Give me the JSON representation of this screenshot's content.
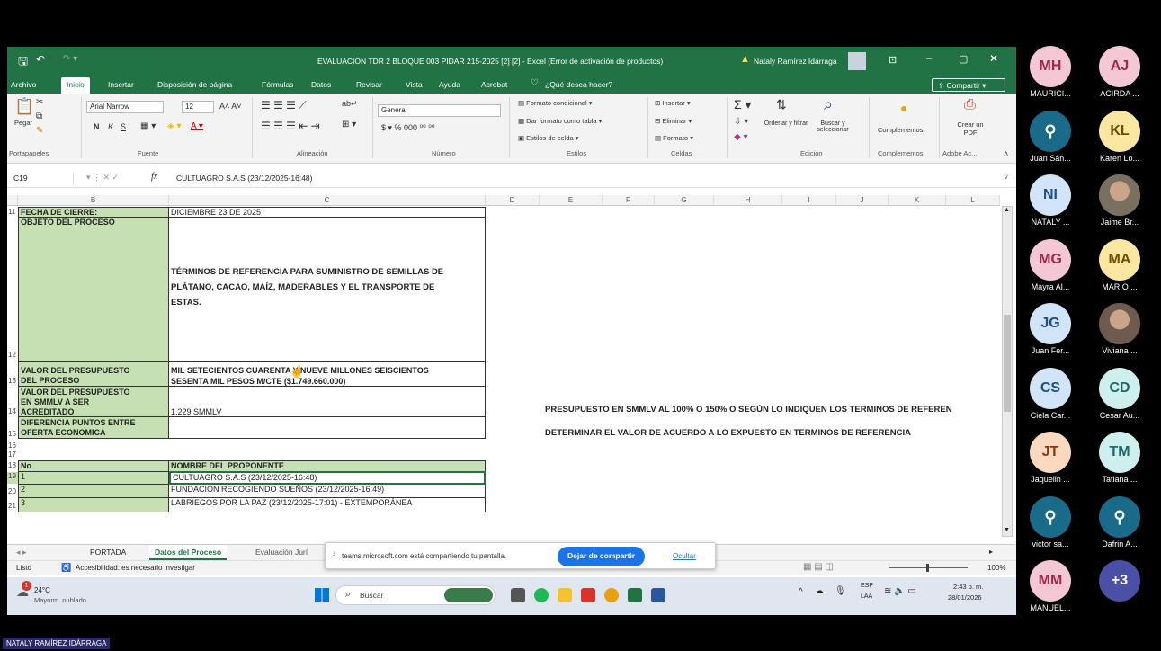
{
  "excel": {
    "doc_title": "EVALUACIÓN TDR 2 BLOQUE 003 PIDAR 215-2025 [2] [2] - Excel (Error de activación de productos)",
    "user_name": "Nataly Ramírez Idárraga",
    "tabs": [
      "Archivo",
      "Inicio",
      "Insertar",
      "Disposición de página",
      "Fórmulas",
      "Datos",
      "Revisar",
      "Vista",
      "Ayuda",
      "Acrobat"
    ],
    "search_placeholder": "¿Qué desea hacer?",
    "share_label": "Compartir",
    "ribbon": {
      "paste": "Pegar",
      "clipboard_group": "Portapapeles",
      "font_name": "Arial Narrow",
      "font_size": "12",
      "bold": "N",
      "italic": "K",
      "underline": "S",
      "font_group": "Fuente",
      "align_group": "Alineación",
      "number_format": "General",
      "number_group": "Número",
      "conditional": "Formato condicional",
      "as_table": "Dar formato como tabla",
      "cell_styles": "Estilos de celda",
      "styles_group": "Estilos",
      "insert": "Insertar",
      "delete": "Eliminar",
      "format": "Formato",
      "cells_group": "Celdas",
      "sort": "Ordenar y filtrar",
      "find": "Buscar y seleccionar",
      "edit_group": "Edición",
      "addins": "Complementos",
      "addins_group": "Complementos",
      "pdf": "Crear un PDF",
      "adobe_group": "Adobe Ac..."
    },
    "name_box": "C19",
    "formula": "CULTUAGRO S.A.S (23/12/2025-16:48)",
    "columns": [
      "B",
      "C",
      "D",
      "E",
      "F",
      "G",
      "H",
      "I",
      "J",
      "K",
      "L"
    ],
    "rows": [
      {
        "num": "11",
        "b": "FECHA DE CIERRE:",
        "c": "DICIEMBRE 23 DE 2025"
      },
      {
        "num": "12",
        "b": "OBJETO DEL PROCESO",
        "c_lines": [
          "TÉRMINOS DE REFERENCIA PARA SUMINISTRO DE SEMILLAS DE",
          "PLÁTANO, CACAO, MAÍZ, MADERABLES Y EL TRANSPORTE DE",
          "ESTAS."
        ]
      },
      {
        "num": "13",
        "b_lines": [
          "VALOR DEL PRESUPUESTO",
          "DEL PROCESO"
        ],
        "c_lines": [
          "MIL SETECIENTOS CUARENTA Y NUEVE MILLONES SEISCIENTOS",
          "SESENTA MIL PESOS M/CTE ($1.749.660.000)"
        ]
      },
      {
        "num": "14",
        "b_lines": [
          "VALOR DEL PRESUPUESTO",
          "EN SMMLV A SER",
          "ACREDITADO"
        ],
        "c": "1.229 SMMLV",
        "e": "PRESUPUESTO EN SMMLV AL 100% O 150% O SEGÚN LO INDIQUEN LOS TERMINOS DE REFEREN"
      },
      {
        "num": "15",
        "b_lines": [
          "DIFERENCIA PUNTOS ENTRE",
          "OFERTA ECONOMICA"
        ],
        "e": "DETERMINAR EL VALOR DE ACUERDO A LO EXPUESTO EN TERMINOS DE REFERENCIA"
      },
      {
        "num": "16"
      },
      {
        "num": "17"
      },
      {
        "num": "18",
        "b": "No",
        "c": "NOMBRE DEL PROPONENTE"
      },
      {
        "num": "19",
        "b": "1",
        "c": "CULTUAGRO S.A.S (23/12/2025-16:48)"
      },
      {
        "num": "20",
        "b": "2",
        "c": "FUNDACIÓN RECOGIENDO SUEÑOS (23/12/2025-16:49)"
      },
      {
        "num": "21",
        "b": "3",
        "c": "LABRIEGOS POR LA PAZ (23/12/2025-17:01) - EXTEMPORÁNEA"
      }
    ],
    "sheets": [
      "PORTADA",
      "Datos del Proceso",
      "Evaluación Jurí"
    ],
    "status": {
      "ready": "Listo",
      "accessibility": "Accesibilidad: es necesario investigar",
      "zoom": "100%"
    },
    "share_msg": "teams.microsoft.com está compartiendo tu pantalla.",
    "stop_share": "Dejar de compartir",
    "hide": "Ocultar"
  },
  "taskbar": {
    "temp": "24°C",
    "weather": "Mayorm. nublado",
    "weather_badge": "1",
    "search": "Buscar",
    "lang1": "ESP",
    "lang2": "LAA",
    "time": "2:43 p. m.",
    "date": "28/01/2026"
  },
  "participants": [
    {
      "initials": "MH",
      "name": "MAURICI...",
      "bg": "#f4c7d4",
      "fg": "#9c2a4f"
    },
    {
      "initials": "AJ",
      "name": "ACIRDA ...",
      "bg": "#f4c7d4",
      "fg": "#9c2a4f"
    },
    {
      "initials": "",
      "icon": "person-icon",
      "name": "Juan Sán...",
      "bg": "#1a6b8a",
      "fg": "#fff"
    },
    {
      "initials": "KL",
      "name": "Karen Lo...",
      "bg": "#fce7a2",
      "fg": "#6b4e00"
    },
    {
      "initials": "NI",
      "name": "NATALY ...",
      "bg": "#d2e4f7",
      "fg": "#1d4f8a"
    },
    {
      "initials": "",
      "photo": true,
      "name": "Jaime Br...",
      "bg": "#7a7060",
      "fg": "#fff"
    },
    {
      "initials": "MG",
      "name": "Mayra Al...",
      "bg": "#f4c7d4",
      "fg": "#9c2a4f"
    },
    {
      "initials": "MA",
      "name": "MARIO ...",
      "bg": "#fce7a2",
      "fg": "#6b4e00"
    },
    {
      "initials": "JG",
      "name": "Juan Fer...",
      "bg": "#d2e4f7",
      "fg": "#1d4f8a"
    },
    {
      "initials": "",
      "photo": true,
      "name": "Viviana ...",
      "bg": "#6e5a4e",
      "fg": "#fff"
    },
    {
      "initials": "CS",
      "name": "Ciela Car...",
      "bg": "#d2e4f7",
      "fg": "#1d4f8a"
    },
    {
      "initials": "CD",
      "name": "Cesar Au...",
      "bg": "#cfeeee",
      "fg": "#1d6a6a"
    },
    {
      "initials": "JT",
      "name": "Jaquelin ...",
      "bg": "#fbd8c0",
      "fg": "#8a3a0a"
    },
    {
      "initials": "TM",
      "name": "Tatiana ...",
      "bg": "#cfeeee",
      "fg": "#1d6a6a"
    },
    {
      "initials": "",
      "icon": "person-icon",
      "name": "victor sa...",
      "bg": "#1a6b8a",
      "fg": "#fff"
    },
    {
      "initials": "",
      "icon": "person-icon",
      "name": "Dafrin A...",
      "bg": "#1a6b8a",
      "fg": "#fff"
    },
    {
      "initials": "MM",
      "name": "MANUEL...",
      "bg": "#f4c7d4",
      "fg": "#9c2a4f"
    },
    {
      "initials": "+3",
      "name": "",
      "bg": "#4b4fa6",
      "fg": "#fff"
    }
  ],
  "presenter": "NATALY RAMÍREZ IDÁRRAGA"
}
